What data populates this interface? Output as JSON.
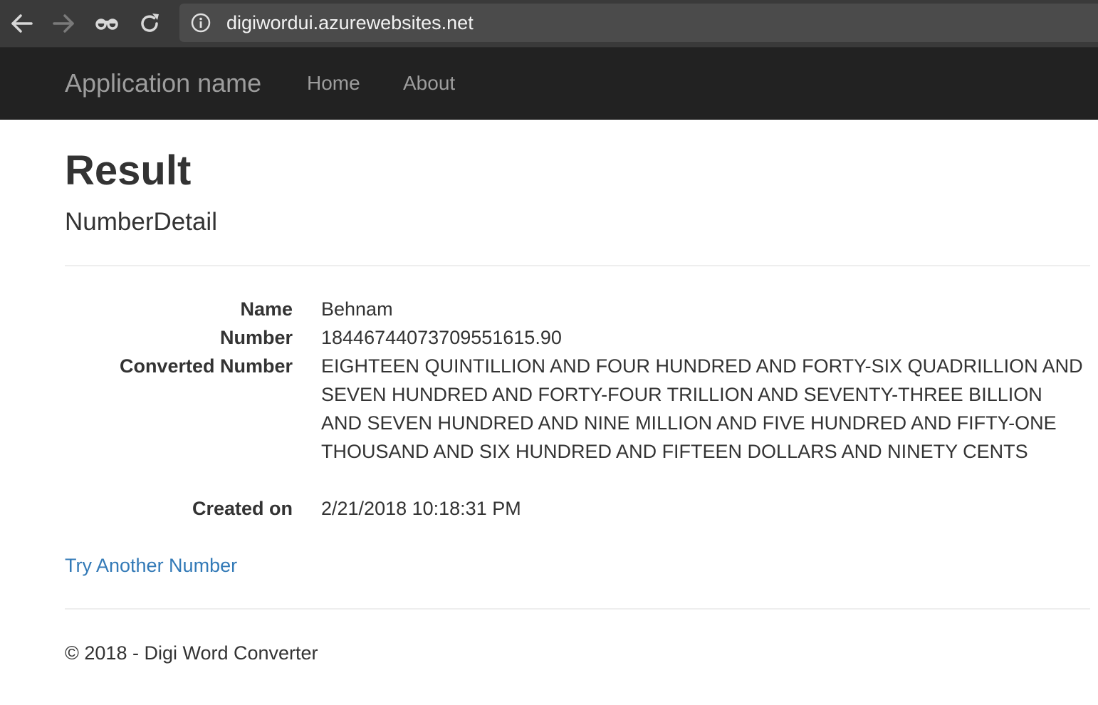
{
  "browser": {
    "url": "digiwordui.azurewebsites.net",
    "icons": [
      "back-arrow-icon",
      "forward-arrow-icon",
      "incognito-icon",
      "reload-icon",
      "info-icon"
    ]
  },
  "navbar": {
    "brand": "Application name",
    "links": [
      "Home",
      "About"
    ]
  },
  "main": {
    "title": "Result",
    "subtitle": "NumberDetail",
    "details": [
      {
        "label": "Name",
        "value": "Behnam"
      },
      {
        "label": "Number",
        "value": "18446744073709551615.90"
      },
      {
        "label": "Converted Number",
        "value": "EIGHTEEN QUINTILLION AND FOUR HUNDRED AND FORTY-SIX QUADRILLION AND SEVEN HUNDRED AND FORTY-FOUR TRILLION AND SEVENTY-THREE BILLION AND SEVEN HUNDRED AND NINE MILLION AND FIVE HUNDRED AND FIFTY-ONE THOUSAND AND SIX HUNDRED AND FIFTEEN DOLLARS AND NINETY CENTS"
      },
      {
        "label": "Created on",
        "value": "2/21/2018 10:18:31 PM"
      }
    ],
    "try_again_link": "Try Another Number"
  },
  "footer": {
    "text": "© 2018 - Digi Word Converter"
  },
  "colors": {
    "navbar_bg": "#222222",
    "nav_text": "#9d9d9d",
    "link": "#337ab7",
    "text": "#333333"
  }
}
